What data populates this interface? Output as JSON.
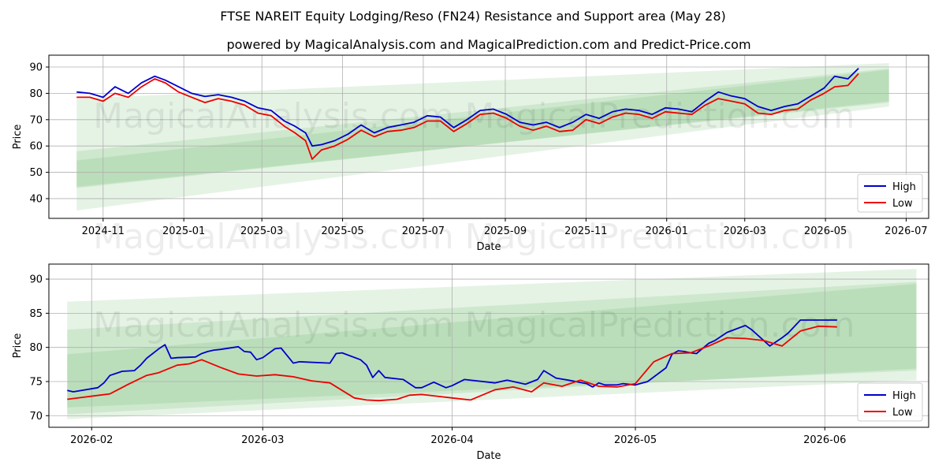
{
  "title": "FTSE NAREIT Equity Lodging/Reso (FN24) Resistance and Support area (May 28)",
  "subtitle": "powered by MagicalAnalysis.com and MagicalPrediction.com and Predict-Price.com",
  "watermarks": [
    "MagicalAnalysis.com",
    "MagicalPrediction.com"
  ],
  "colors": {
    "high": "#0000cc",
    "low": "#ee0000",
    "band": "#2ca02c",
    "grid": "#b0b0b0"
  },
  "chart_data": [
    {
      "type": "line",
      "xlabel": "Date",
      "ylabel": "Price",
      "x_ticks": [
        "2024-11",
        "2025-01",
        "2025-03",
        "2025-05",
        "2025-07",
        "2025-09",
        "2025-11",
        "2026-01",
        "2026-03",
        "2026-05",
        "2026-07"
      ],
      "y_ticks": [
        40,
        50,
        60,
        70,
        80,
        90
      ],
      "xlim": [
        "2024-09-21",
        "2026-07-18"
      ],
      "ylim": [
        32.5,
        94.5
      ],
      "grid": true,
      "legend": "bottom-right",
      "series": [
        {
          "name": "High",
          "x": [
            "2024-10-12",
            "2024-10-22",
            "2024-11-01",
            "2024-11-10",
            "2024-11-20",
            "2024-11-30",
            "2024-12-10",
            "2024-12-18",
            "2024-12-28",
            "2025-01-07",
            "2025-01-17",
            "2025-01-27",
            "2025-02-06",
            "2025-02-16",
            "2025-02-26",
            "2025-03-08",
            "2025-03-18",
            "2025-03-26",
            "2025-04-03",
            "2025-04-08",
            "2025-04-15",
            "2025-04-25",
            "2025-05-05",
            "2025-05-15",
            "2025-05-25",
            "2025-06-04",
            "2025-06-14",
            "2025-06-24",
            "2025-07-04",
            "2025-07-14",
            "2025-07-24",
            "2025-08-03",
            "2025-08-13",
            "2025-08-23",
            "2025-09-02",
            "2025-09-12",
            "2025-09-22",
            "2025-10-02",
            "2025-10-12",
            "2025-10-22",
            "2025-11-01",
            "2025-11-11",
            "2025-11-21",
            "2025-12-01",
            "2025-12-11",
            "2025-12-21",
            "2025-12-31",
            "2026-01-10",
            "2026-01-20",
            "2026-01-30",
            "2026-02-09",
            "2026-02-19",
            "2026-03-01",
            "2026-03-11",
            "2026-03-21",
            "2026-03-31",
            "2026-04-10",
            "2026-04-20",
            "2026-04-30",
            "2026-05-08",
            "2026-05-18",
            "2026-05-26"
          ],
          "values": [
            80.5,
            80,
            78.5,
            82.5,
            80,
            84,
            86.5,
            85,
            82.5,
            80,
            78.8,
            79.5,
            78.5,
            77,
            74.5,
            73.5,
            69.5,
            67.5,
            65,
            60,
            60.5,
            62,
            64.5,
            68,
            65,
            67,
            68,
            69,
            71.5,
            71,
            67,
            70,
            73.5,
            74,
            72,
            69,
            68,
            69,
            67,
            69,
            72,
            70.5,
            73,
            74,
            73.5,
            72,
            74.5,
            74,
            73,
            77,
            80.5,
            79,
            78,
            75,
            73.5,
            75,
            76,
            79,
            82,
            86.5,
            85.5,
            89.5
          ]
        },
        {
          "name": "Low",
          "x": [
            "2024-10-12",
            "2024-10-22",
            "2024-11-01",
            "2024-11-10",
            "2024-11-20",
            "2024-11-30",
            "2024-12-10",
            "2024-12-18",
            "2024-12-28",
            "2025-01-07",
            "2025-01-17",
            "2025-01-27",
            "2025-02-06",
            "2025-02-16",
            "2025-02-26",
            "2025-03-08",
            "2025-03-18",
            "2025-03-26",
            "2025-04-03",
            "2025-04-08",
            "2025-04-15",
            "2025-04-25",
            "2025-05-05",
            "2025-05-15",
            "2025-05-25",
            "2025-06-04",
            "2025-06-14",
            "2025-06-24",
            "2025-07-04",
            "2025-07-14",
            "2025-07-24",
            "2025-08-03",
            "2025-08-13",
            "2025-08-23",
            "2025-09-02",
            "2025-09-12",
            "2025-09-22",
            "2025-10-02",
            "2025-10-12",
            "2025-10-22",
            "2025-11-01",
            "2025-11-11",
            "2025-11-21",
            "2025-12-01",
            "2025-12-11",
            "2025-12-21",
            "2025-12-31",
            "2026-01-10",
            "2026-01-20",
            "2026-01-30",
            "2026-02-09",
            "2026-02-19",
            "2026-03-01",
            "2026-03-11",
            "2026-03-21",
            "2026-03-31",
            "2026-04-10",
            "2026-04-20",
            "2026-04-30",
            "2026-05-08",
            "2026-05-18",
            "2026-05-26"
          ],
          "values": [
            78.5,
            78.5,
            77,
            80,
            78.5,
            82.5,
            85.5,
            84,
            80.5,
            78.5,
            76.5,
            78,
            77,
            75.5,
            72.5,
            71.5,
            67.5,
            65,
            62,
            55,
            58.5,
            60,
            62.5,
            66,
            63.5,
            65.5,
            66,
            67,
            69.5,
            69.5,
            65.5,
            68.5,
            72,
            72.5,
            70.5,
            67.5,
            66,
            67.5,
            65.5,
            66,
            70,
            68.5,
            71,
            72.5,
            72,
            70.5,
            73,
            72.5,
            72,
            75.5,
            78,
            77,
            76,
            72.5,
            72,
            73.5,
            74,
            77.5,
            80,
            82.5,
            83,
            87.5
          ]
        }
      ],
      "bands": [
        {
          "start": "2024-10-12",
          "end": "2026-06-18",
          "upper": [
            78,
            91.5
          ],
          "lower": [
            35.5,
            75
          ]
        },
        {
          "start": "2024-10-12",
          "end": "2026-06-18",
          "upper": [
            58,
            89.5
          ],
          "lower": [
            44,
            77
          ]
        },
        {
          "start": "2024-10-12",
          "end": "2026-06-18",
          "upper": [
            54.5,
            89
          ],
          "lower": [
            44.5,
            76.5
          ]
        }
      ]
    },
    {
      "type": "line",
      "xlabel": "Date",
      "ylabel": "Price",
      "x_ticks": [
        "2026-02",
        "2026-03",
        "2026-04",
        "2026-05",
        "2026-06"
      ],
      "y_ticks": [
        70,
        75,
        80,
        85,
        90
      ],
      "xlim": [
        "2026-01-25",
        "2026-06-18"
      ],
      "ylim": [
        68.3,
        92.2
      ],
      "grid": true,
      "legend": "bottom-right",
      "series": [
        {
          "name": "High",
          "x": [
            "2026-01-28",
            "2026-01-29",
            "2026-02-02",
            "2026-02-03",
            "2026-02-04",
            "2026-02-05",
            "2026-02-06",
            "2026-02-08",
            "2026-02-09",
            "2026-02-10",
            "2026-02-12",
            "2026-02-13",
            "2026-02-14",
            "2026-02-15",
            "2026-02-18",
            "2026-02-19",
            "2026-02-20",
            "2026-02-21",
            "2026-02-22",
            "2026-02-25",
            "2026-02-26",
            "2026-02-27",
            "2026-02-28",
            "2026-03-01",
            "2026-03-03",
            "2026-03-04",
            "2026-03-05",
            "2026-03-06",
            "2026-03-07",
            "2026-03-12",
            "2026-03-13",
            "2026-03-14",
            "2026-03-17",
            "2026-03-18",
            "2026-03-19",
            "2026-03-20",
            "2026-03-21",
            "2026-03-24",
            "2026-03-26",
            "2026-03-27",
            "2026-03-29",
            "2026-03-31",
            "2026-04-01",
            "2026-04-03",
            "2026-04-08",
            "2026-04-10",
            "2026-04-13",
            "2026-04-15",
            "2026-04-16",
            "2026-04-18",
            "2026-04-20",
            "2026-04-23",
            "2026-04-24",
            "2026-04-25",
            "2026-04-26",
            "2026-04-28",
            "2026-04-29",
            "2026-05-01",
            "2026-05-03",
            "2026-05-06",
            "2026-05-07",
            "2026-05-08",
            "2026-05-09",
            "2026-05-10",
            "2026-05-11",
            "2026-05-13",
            "2026-05-14",
            "2026-05-16",
            "2026-05-19",
            "2026-05-20",
            "2026-05-23",
            "2026-05-25",
            "2026-05-26",
            "2026-05-28",
            "2026-06-03"
          ],
          "values": [
            73.7,
            73.5,
            74.1,
            74.8,
            75.9,
            76.2,
            76.5,
            76.6,
            77.4,
            78.4,
            79.8,
            80.4,
            78.4,
            78.5,
            78.6,
            79.1,
            79.4,
            79.6,
            79.7,
            80.1,
            79.4,
            79.3,
            78.2,
            78.5,
            79.8,
            79.9,
            78.8,
            77.7,
            77.9,
            77.7,
            79.1,
            79.2,
            78.2,
            77.4,
            75.6,
            76.6,
            75.6,
            75.3,
            74.1,
            74.1,
            74.9,
            74.1,
            74.4,
            75.3,
            74.8,
            75.2,
            74.6,
            75.3,
            76.6,
            75.5,
            75.2,
            74.7,
            74.2,
            74.8,
            74.5,
            74.5,
            74.7,
            74.5,
            75.0,
            77.0,
            79.0,
            79.5,
            79.4,
            79.2,
            79.1,
            80.6,
            81.0,
            82.2,
            83.2,
            82.6,
            80.2,
            81.4,
            82.1,
            84.0,
            84.0
          ]
        },
        {
          "name": "Low",
          "x": [
            "2026-01-28",
            "2026-02-04",
            "2026-02-07",
            "2026-02-10",
            "2026-02-12",
            "2026-02-15",
            "2026-02-17",
            "2026-02-19",
            "2026-02-22",
            "2026-02-25",
            "2026-02-28",
            "2026-03-03",
            "2026-03-06",
            "2026-03-09",
            "2026-03-12",
            "2026-03-16",
            "2026-03-18",
            "2026-03-20",
            "2026-03-23",
            "2026-03-25",
            "2026-03-27",
            "2026-03-30",
            "2026-04-01",
            "2026-04-04",
            "2026-04-08",
            "2026-04-11",
            "2026-04-14",
            "2026-04-16",
            "2026-04-19",
            "2026-04-22",
            "2026-04-25",
            "2026-04-28",
            "2026-05-01",
            "2026-05-04",
            "2026-05-07",
            "2026-05-10",
            "2026-05-13",
            "2026-05-16",
            "2026-05-19",
            "2026-05-22",
            "2026-05-25",
            "2026-05-28",
            "2026-05-31",
            "2026-06-03"
          ],
          "values": [
            72.4,
            73.2,
            74.6,
            75.9,
            76.3,
            77.4,
            77.6,
            78.2,
            77.1,
            76.1,
            75.8,
            76.0,
            75.7,
            75.1,
            74.8,
            72.6,
            72.3,
            72.2,
            72.4,
            73.0,
            73.1,
            72.8,
            72.6,
            72.3,
            73.8,
            74.2,
            73.5,
            74.8,
            74.3,
            75.2,
            74.3,
            74.2,
            74.7,
            77.9,
            79.1,
            79.2,
            80.2,
            81.4,
            81.3,
            81.0,
            80.2,
            82.4,
            83.1,
            83.0
          ]
        }
      ],
      "bands": [
        {
          "start": "2026-01-28",
          "end": "2026-06-16",
          "upper": [
            86.7,
            91.5
          ],
          "lower": [
            69.5,
            75.2
          ]
        },
        {
          "start": "2026-01-28",
          "end": "2026-06-16",
          "upper": [
            82.6,
            89.6
          ],
          "lower": [
            70.2,
            76.9
          ]
        },
        {
          "start": "2026-01-28",
          "end": "2026-06-16",
          "upper": [
            79.0,
            89.3
          ],
          "lower": [
            71.2,
            76.6
          ]
        }
      ]
    }
  ]
}
